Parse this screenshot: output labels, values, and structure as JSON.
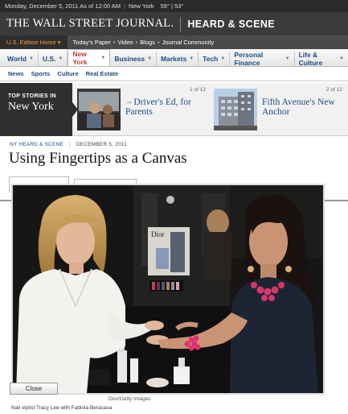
{
  "topbar": {
    "date": "Monday, December 5, 2011 As of 12:00 AM",
    "location": "New York",
    "weather": "59° | 53°"
  },
  "masthead": {
    "logo": "THE WALL STREET JOURNAL.",
    "section": "HEARD & SCENE"
  },
  "editionbar": {
    "edition": "U.S. Edition Home ▾",
    "links": [
      "Today's Paper",
      "Video",
      "Blogs",
      "Journal Community"
    ]
  },
  "nav": {
    "tabs": [
      "World",
      "U.S.",
      "New York",
      "Business",
      "Markets",
      "Tech",
      "Personal Finance",
      "Life & Culture"
    ],
    "active": "New York"
  },
  "subnav": {
    "items": [
      "News",
      "Sports",
      "Culture",
      "Real Estate"
    ]
  },
  "topstories": {
    "label_small": "TOP STORIES IN",
    "label_big": "New York",
    "stories": [
      {
        "count": "1 of 12",
        "headline": "Driver's Ed, for Parents"
      },
      {
        "count": "2 of 12",
        "headline": "Fifth Avenue's New Anchor"
      }
    ]
  },
  "article": {
    "kicker": "NY HEARD & SCENE",
    "date": "DECEMBER 5, 2011",
    "title": "Using Fingertips as a Canvas"
  },
  "lightbox": {
    "close_label": "Close",
    "credit": "Dior/Getty Images",
    "caption": "Nail stylist Tracy Lee with Fabiola Beracasa",
    "poster_text": "Dior"
  },
  "colors": {
    "accent": "#c8362b",
    "link": "#1d4a86",
    "edition": "#f0a040"
  }
}
